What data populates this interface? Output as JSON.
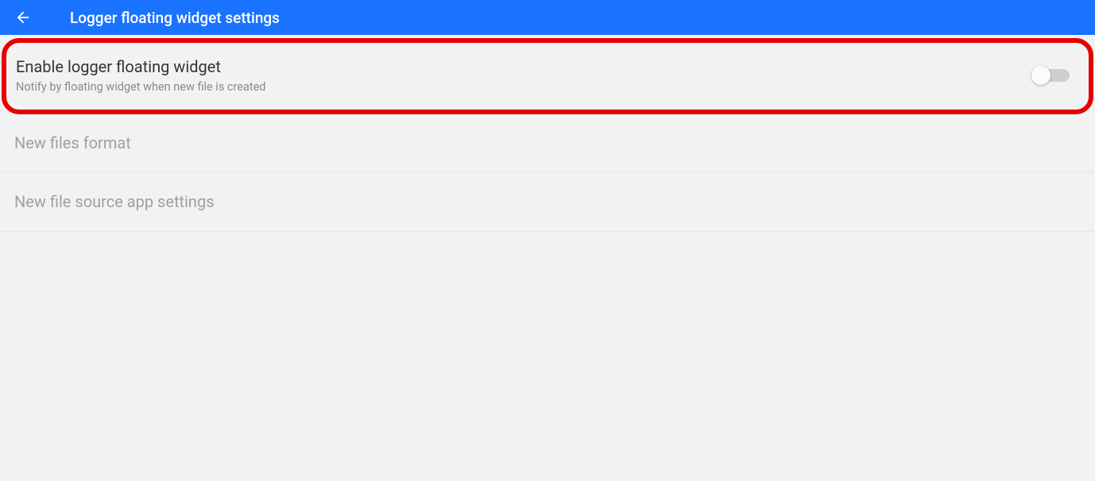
{
  "header": {
    "title": "Logger floating widget settings"
  },
  "settings": {
    "enable_widget": {
      "title": "Enable logger floating widget",
      "subtitle": "Notify by floating widget when new file is created",
      "enabled": false
    },
    "new_files_format": {
      "title": "New files format"
    },
    "source_app": {
      "title": "New file source app settings"
    }
  }
}
